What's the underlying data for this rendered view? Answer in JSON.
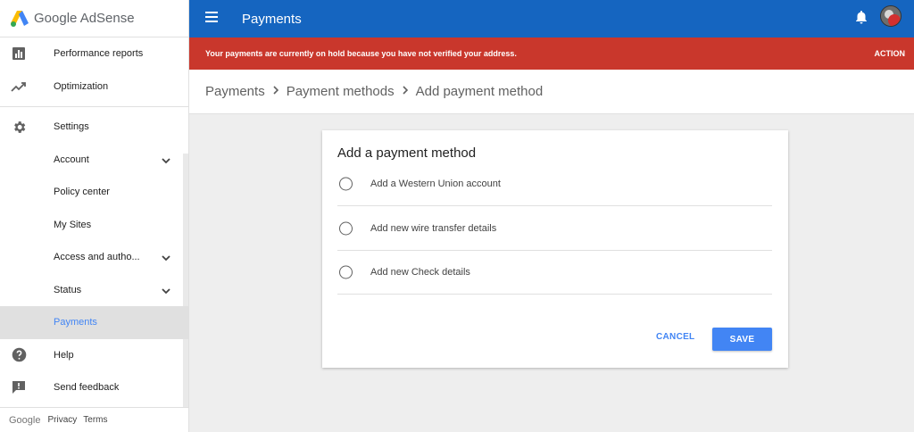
{
  "app": {
    "logo_text": "Google AdSense",
    "page_title": "Payments"
  },
  "sidebar": {
    "items": [
      {
        "label": "Performance reports",
        "icon": "bar-chart-icon"
      },
      {
        "label": "Optimization",
        "icon": "trending-up-icon"
      },
      {
        "label": "Settings",
        "icon": "gear-icon"
      },
      {
        "label": "Account",
        "icon": "",
        "chevron": true
      },
      {
        "label": "Policy center",
        "icon": ""
      },
      {
        "label": "My Sites",
        "icon": ""
      },
      {
        "label": "Access and autho...",
        "icon": "",
        "chevron": true
      },
      {
        "label": "Status",
        "icon": "",
        "chevron": true
      },
      {
        "label": "Payments",
        "icon": "",
        "active": true
      },
      {
        "label": "Help",
        "icon": "help-circle-icon"
      },
      {
        "label": "Send feedback",
        "icon": "feedback-icon"
      }
    ],
    "footer": {
      "brand": "Google",
      "privacy": "Privacy",
      "terms": "Terms"
    }
  },
  "alert": {
    "message": "Your payments are currently on hold because you have not verified your address.",
    "action": "ACTION"
  },
  "breadcrumb": [
    "Payments",
    "Payment methods",
    "Add payment method"
  ],
  "card": {
    "title": "Add a payment method",
    "options": [
      "Add a Western Union account",
      "Add new wire transfer details",
      "Add new Check details"
    ],
    "cancel_label": "CANCEL",
    "save_label": "SAVE"
  },
  "colors": {
    "topbar": "#1565c0",
    "alert": "#c9372c",
    "accent": "#4285f4"
  }
}
